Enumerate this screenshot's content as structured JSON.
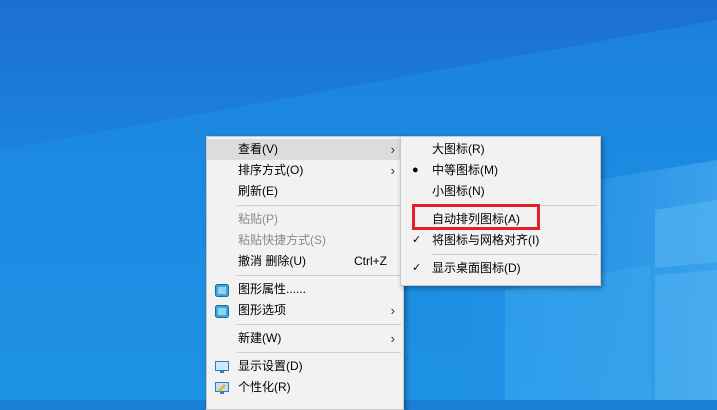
{
  "main_menu": {
    "items": [
      {
        "label": "查看(V)",
        "submenu": true
      },
      {
        "label": "排序方式(O)",
        "submenu": true
      },
      {
        "label": "刷新(E)"
      },
      {
        "label": "粘贴(P)",
        "disabled": true
      },
      {
        "label": "粘贴快捷方式(S)",
        "disabled": true
      },
      {
        "label": "撤消 删除(U)",
        "shortcut": "Ctrl+Z"
      },
      {
        "label": "图形属性......",
        "icon": "graphics-properties-icon"
      },
      {
        "label": "图形选项",
        "icon": "graphics-options-icon",
        "submenu": true
      },
      {
        "label": "新建(W)",
        "submenu": true
      },
      {
        "label": "显示设置(D)",
        "icon": "display-settings-icon"
      },
      {
        "label": "个性化(R)",
        "icon": "personalize-icon"
      }
    ]
  },
  "view_submenu": {
    "items": [
      {
        "label": "大图标(R)"
      },
      {
        "label": "中等图标(M)",
        "mark": "bullet"
      },
      {
        "label": "小图标(N)"
      },
      {
        "label": "自动排列图标(A)"
      },
      {
        "label": "将图标与网格对齐(I)",
        "mark": "check"
      },
      {
        "label": "显示桌面图标(D)",
        "mark": "check"
      }
    ]
  },
  "highlight_color": "#e0232a"
}
